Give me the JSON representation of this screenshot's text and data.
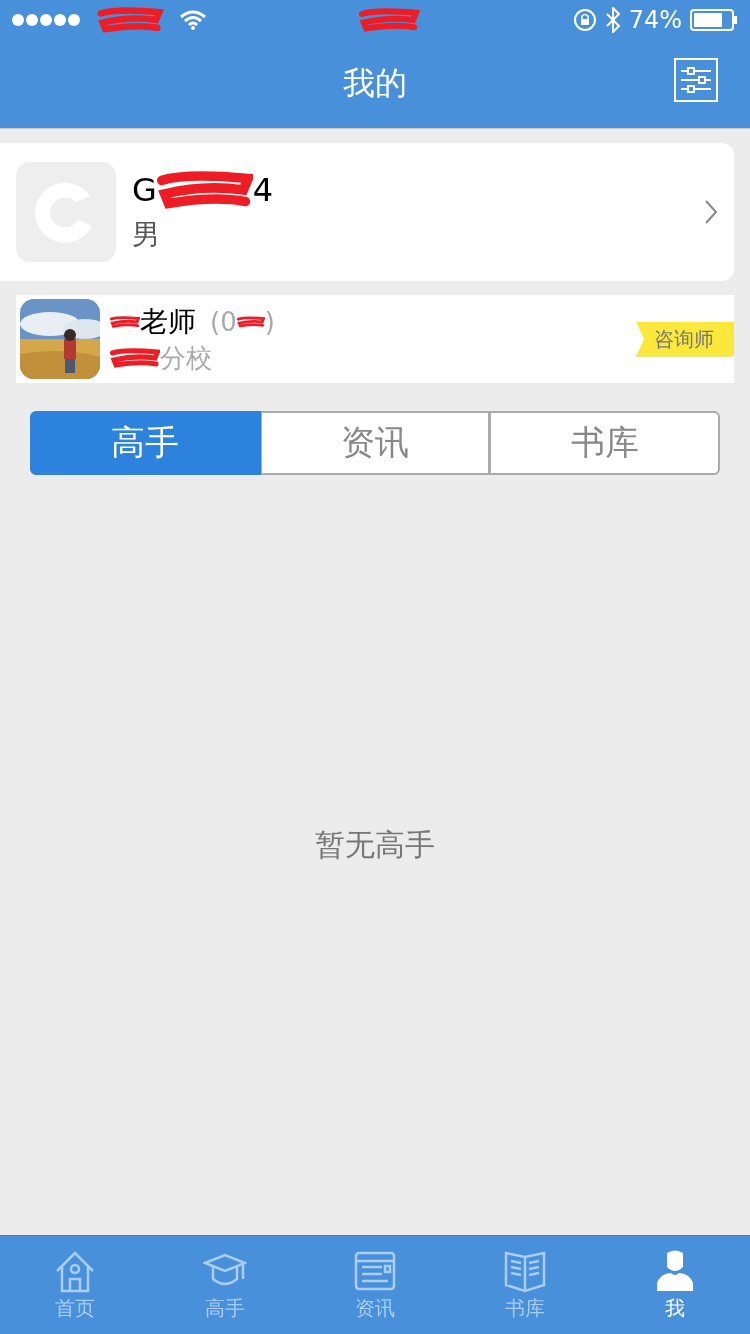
{
  "status_bar": {
    "battery_text": "74%"
  },
  "nav": {
    "title": "我的"
  },
  "profile": {
    "name_start": "G",
    "name_end": "4",
    "gender": "男"
  },
  "teacher": {
    "name": "老师",
    "id_start": "(0",
    "id_end": ")",
    "school": "分校",
    "badge": "咨询师"
  },
  "segments": [
    {
      "label": "高手",
      "selected": true
    },
    {
      "label": "资讯",
      "selected": false
    },
    {
      "label": "书库",
      "selected": false
    }
  ],
  "empty_text": "暂无高手",
  "tabbar": [
    {
      "kind": "home",
      "label": "首页",
      "selected": false
    },
    {
      "kind": "cap",
      "label": "高手",
      "selected": false
    },
    {
      "kind": "news",
      "label": "资讯",
      "selected": false
    },
    {
      "kind": "book",
      "label": "书库",
      "selected": false
    },
    {
      "kind": "person",
      "label": "我",
      "selected": true
    }
  ]
}
